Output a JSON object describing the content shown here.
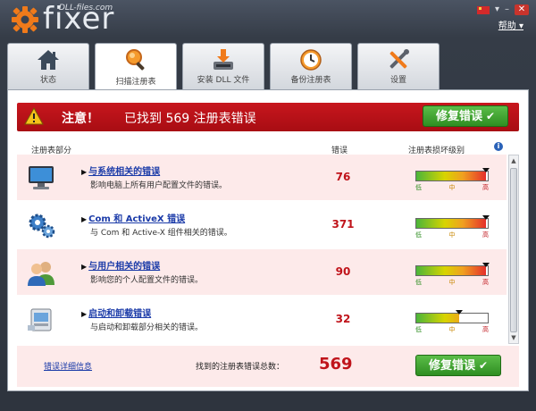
{
  "app": {
    "brand_sub": "DLL-files.com",
    "brand_name": "fixer",
    "help": "帮助 ▾"
  },
  "tabs": [
    {
      "label": "状态",
      "icon": "home-icon"
    },
    {
      "label": "扫描注册表",
      "icon": "magnifier-icon"
    },
    {
      "label": "安装 DLL 文件",
      "icon": "download-icon"
    },
    {
      "label": "备份注册表",
      "icon": "clock-icon"
    },
    {
      "label": "设置",
      "icon": "tools-icon"
    }
  ],
  "banner": {
    "title": "注意！",
    "message": "已找到 569 注册表错误",
    "fix_label": "修复错误"
  },
  "columns": {
    "section": "注册表部分",
    "errors": "错误",
    "level": "注册表损坏级别"
  },
  "rows": [
    {
      "title": "与系统相关的错误",
      "desc": "影响电脑上所有用户配置文件的错误。",
      "count": "76",
      "level": 0.98,
      "icon": "monitor-icon"
    },
    {
      "title": "Com 和 ActiveX 错误",
      "desc": "与 Com 和 Active-X 组件相关的错误。",
      "count": "371",
      "level": 0.98,
      "icon": "gears-icon"
    },
    {
      "title": "与用户相关的错误",
      "desc": "影响您的个人配置文件的错误。",
      "count": "90",
      "level": 0.98,
      "icon": "users-icon"
    },
    {
      "title": "启动和卸载错误",
      "desc": "与启动和卸载部分相关的错误。",
      "count": "32",
      "level": 0.6,
      "icon": "installer-icon"
    }
  ],
  "meter_labels": [
    "低",
    "中",
    "高"
  ],
  "footer": {
    "details": "错误详细信息",
    "total_label": "找到的注册表错误总数：",
    "total_value": "569",
    "fix_label": "修复错误"
  },
  "colors": {
    "banner": "#b8111a",
    "fix_button": "#3fa32e",
    "row_bg": "#fdeaea"
  }
}
